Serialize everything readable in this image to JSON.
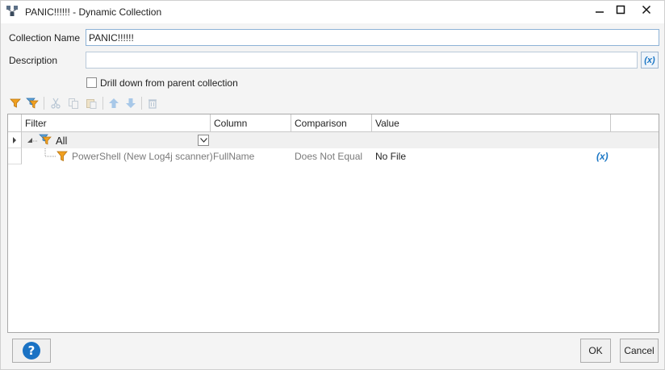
{
  "window": {
    "title": "PANIC!!!!!! - Dynamic Collection",
    "minimize_glyph": "–",
    "maximize_glyph": "☐",
    "close_glyph": "✕"
  },
  "form": {
    "collection_name_label": "Collection Name",
    "collection_name_value": "PANIC!!!!!!",
    "description_label": "Description",
    "description_value": "",
    "variable_button_label": "(x)",
    "drill_down_label": "Drill down from parent collection",
    "drill_down_checked": false
  },
  "toolbar": {
    "icons": [
      "add-filter-icon",
      "add-group-icon",
      "cut-icon",
      "copy-icon",
      "paste-icon",
      "move-up-icon",
      "move-down-icon",
      "delete-icon"
    ]
  },
  "grid": {
    "columns": [
      "Filter",
      "Column",
      "Comparison",
      "Value"
    ],
    "rows": [
      {
        "filter": "All",
        "column": "",
        "comparison": "",
        "value": "",
        "type": "group"
      },
      {
        "filter": "PowerShell (New Log4j scanner)",
        "column": "FullName",
        "comparison": "Does Not Equal",
        "value": "No File",
        "variable": "(x)",
        "type": "filter"
      }
    ]
  },
  "buttons": {
    "help": "?",
    "ok": "OK",
    "cancel": "Cancel"
  },
  "colors": {
    "accent": "#1b77c5",
    "filter_icon": "#f0a020"
  }
}
